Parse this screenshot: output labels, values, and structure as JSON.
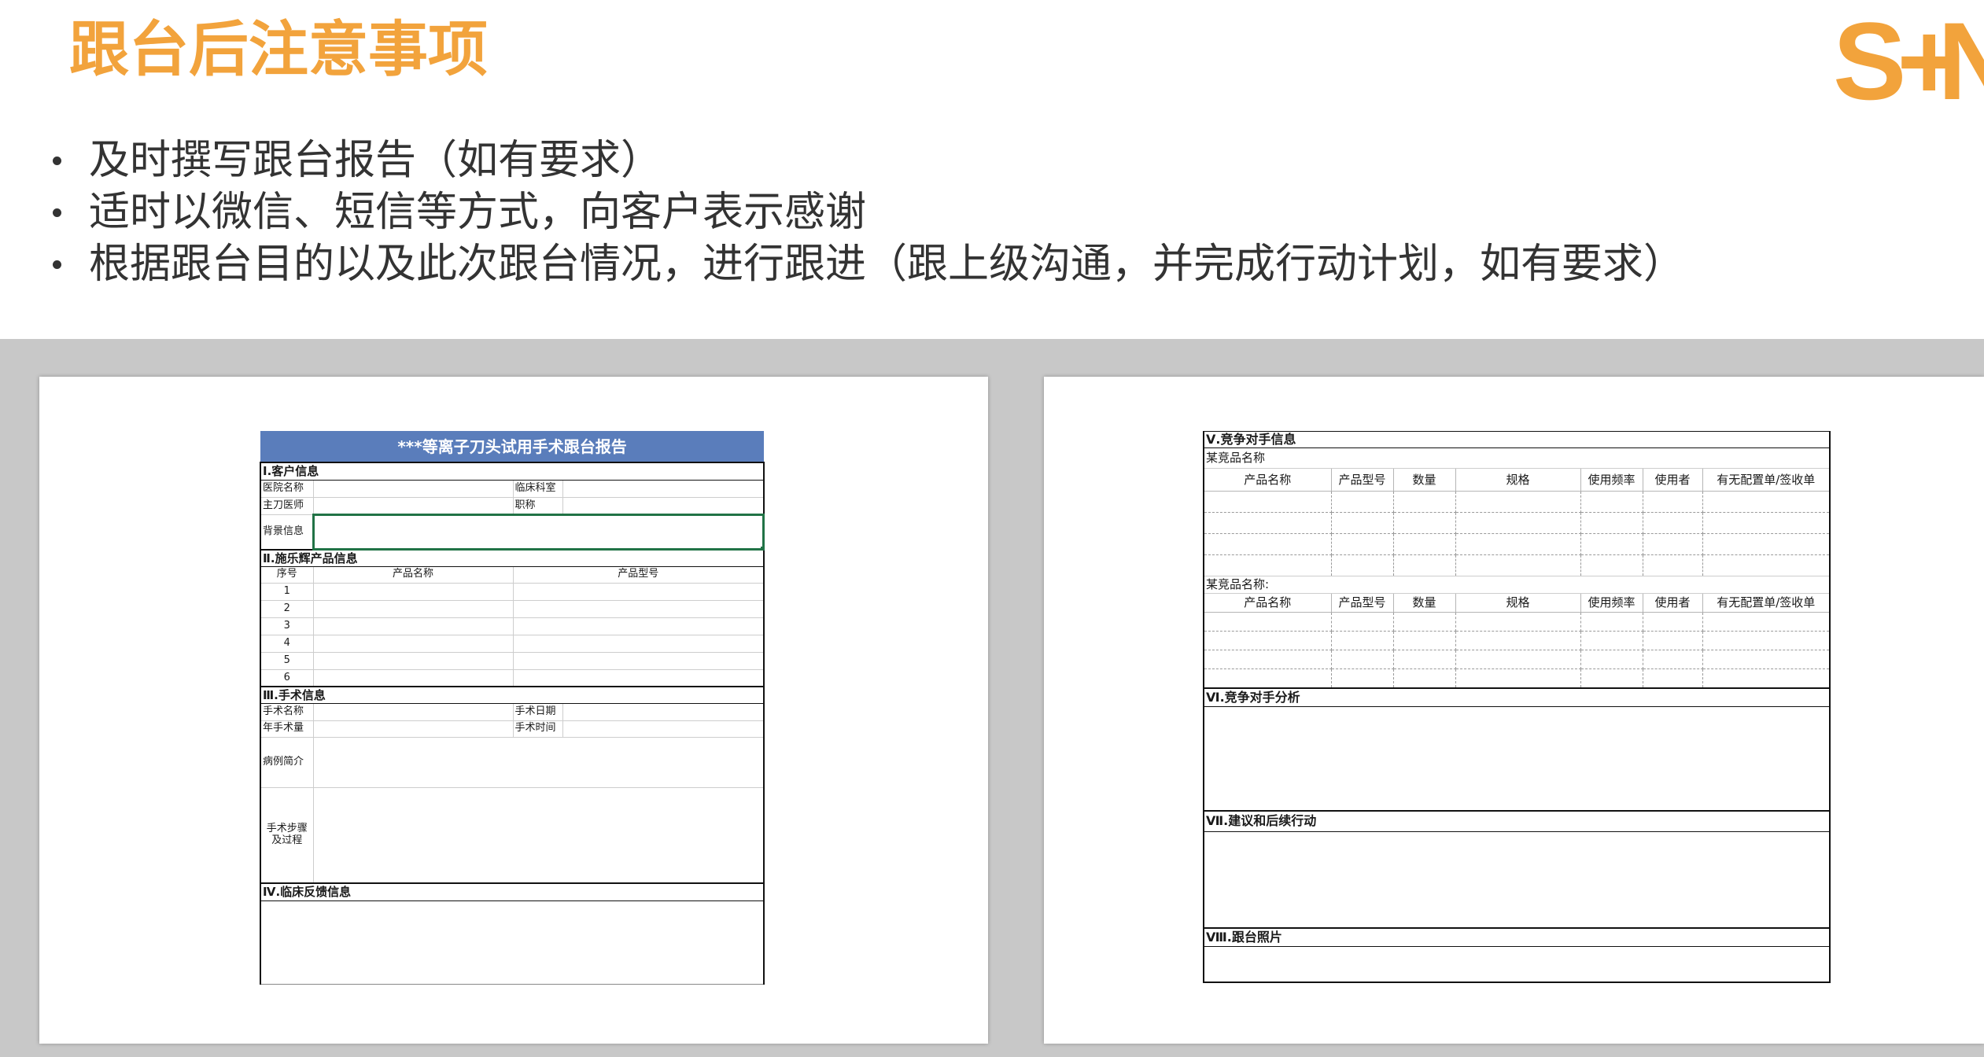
{
  "slide": {
    "title": "跟台后注意事项",
    "logo": {
      "s": "S",
      "plus": "+",
      "n": "N"
    },
    "bullets": [
      "及时撰写跟台报告（如有要求）",
      "适时以微信、短信等方式，向客户表示感谢",
      "根据跟台目的以及此次跟台情况，进行跟进（跟上级沟通，并完成行动计划，如有要求）"
    ]
  },
  "colors": {
    "accent": "#F2A33C",
    "body_text": "#333333",
    "panel_gray": "#C8C8C8",
    "report_header_blue": "#5A7DBB",
    "selection_green": "#217346"
  },
  "report_page_1": {
    "title": "***等离子刀头试用手术跟台报告",
    "customer_section": "Ⅰ.客户信息",
    "customer_fields": {
      "hospital": "医院名称",
      "department": "临床科室",
      "surgeon": "主刀医师",
      "job_title": "职称",
      "background": "背景信息"
    },
    "product_section": "Ⅱ.施乐辉产品信息",
    "product_columns": [
      "序号",
      "产品名称",
      "产品型号"
    ],
    "product_rows": [
      "1",
      "2",
      "3",
      "4",
      "5",
      "6"
    ],
    "surgery_section": "Ⅲ.手术信息",
    "surgery_fields": {
      "name": "手术名称",
      "date": "手术日期",
      "annual_volume": "年手术量",
      "time": "手术时间",
      "case_summary": "病例简介",
      "steps": "手术步骤及过程"
    },
    "feedback_section": "Ⅳ.临床反馈信息"
  },
  "report_page_2": {
    "competitor_section": "Ⅴ.竞争对手信息",
    "competitor_groups": [
      {
        "name_label": "某竞品名称"
      },
      {
        "name_label": "某竞品名称:"
      }
    ],
    "competitor_columns": [
      "产品名称",
      "产品型号",
      "数量",
      "规格",
      "使用频率",
      "使用者",
      "有无配置单/签收单"
    ],
    "analysis_section": "Ⅵ.竞争对手分析",
    "actions_section": "Ⅶ.建议和后续行动",
    "photos_section": "Ⅷ.跟台照片"
  }
}
